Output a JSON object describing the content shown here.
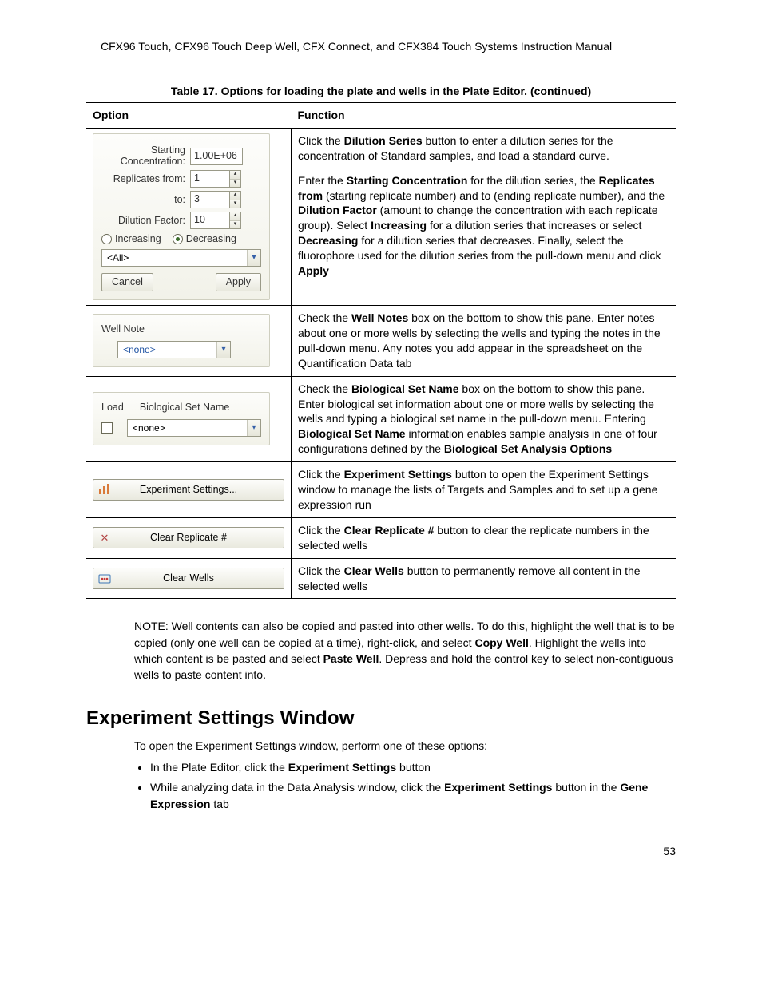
{
  "header": "CFX96 Touch, CFX96 Touch Deep Well, CFX Connect, and CFX384 Touch Systems Instruction Manual",
  "table_caption": "Table 17. Options for loading the plate and wells in the Plate Editor. (continued)",
  "columns": {
    "option": "Option",
    "function": "Function"
  },
  "dilution": {
    "startConcLabel": "Starting Concentration:",
    "startConcValue": "1.00E+06",
    "replFromLabel": "Replicates from:",
    "replFromValue": "1",
    "replToLabel": "to:",
    "replToValue": "3",
    "dilFactorLabel": "Dilution Factor:",
    "dilFactorValue": "10",
    "increasing": "Increasing",
    "decreasing": "Decreasing",
    "allCombo": "<All>",
    "cancel": "Cancel",
    "apply": "Apply"
  },
  "wellnote": {
    "title": "Well Note",
    "combo": "<none>"
  },
  "bio": {
    "load": "Load",
    "title": "Biological Set Name",
    "combo": "<none>"
  },
  "buttons": {
    "expSettings": "Experiment Settings...",
    "clearRep": "Clear Replicate #",
    "clearWells": "Clear Wells"
  },
  "func": {
    "dilution_p1_a": "Click the ",
    "dilution_p1_b": "Dilution Series",
    "dilution_p1_c": " button to enter a dilution series for the concentration of Standard samples, and load a standard curve.",
    "dilution_p2_a": "Enter the ",
    "dilution_p2_b": "Starting Concentration",
    "dilution_p2_c": " for the dilution series, the ",
    "dilution_p2_d": "Replicates from",
    "dilution_p2_e": " (starting replicate number) and to (ending replicate number), and the ",
    "dilution_p2_f": "Dilution Factor",
    "dilution_p2_g": " (amount to change the concentration with each replicate group). Select ",
    "dilution_p2_h": "Increasing",
    "dilution_p2_i": " for a dilution series that increases or select ",
    "dilution_p2_j": "Decreasing",
    "dilution_p2_k": " for a dilution series that decreases. Finally, select the fluorophore used for the dilution series from the pull-down menu and click ",
    "dilution_p2_l": "Apply",
    "wellnote_a": "Check the ",
    "wellnote_b": "Well Notes",
    "wellnote_c": " box on the bottom to show this pane. Enter notes about one or more wells by selecting the wells and typing the notes in the pull-down menu. Any notes you add appear in the spreadsheet on the Quantification Data tab",
    "bio_a": "Check the ",
    "bio_b": "Biological Set Name",
    "bio_c": " box on the bottom to show this pane. Enter biological set information about one or more wells by selecting the wells and typing a biological set name in the pull-down menu. Entering ",
    "bio_d": "Biological Set Name",
    "bio_e": " information enables sample analysis in one of four configurations defined by the ",
    "bio_f": "Biological Set Analysis Options",
    "exp_a": "Click the ",
    "exp_b": "Experiment Settings",
    "exp_c": " button to open the Experiment Settings window to manage the lists of Targets and Samples and to set up a gene expression run",
    "clr_a": "Click the ",
    "clr_b": "Clear Replicate #",
    "clr_c": " button to clear the replicate numbers in the selected wells",
    "clw_a": "Click the ",
    "clw_b": "Clear Wells",
    "clw_c": " button to permanently remove all content in the selected wells"
  },
  "note": {
    "a": "NOTE: Well contents can also be copied and pasted into other wells. To do this, highlight the well that is to be copied (only one well can be copied at a time), right-click, and select ",
    "b": "Copy Well",
    "c": ". Highlight the wells into which content is be pasted and select ",
    "d": "Paste Well",
    "e": ". Depress and hold the control key to select non-contiguous wells to paste content into."
  },
  "section": "Experiment Settings Window",
  "open_intro": "To open the Experiment Settings window, perform one of these options:",
  "bullets": {
    "b1_a": "In the Plate Editor, click the ",
    "b1_b": "Experiment Settings",
    "b1_c": " button",
    "b2_a": "While analyzing data in the Data Analysis window, click the ",
    "b2_b": "Experiment Settings",
    "b2_c": " button in the ",
    "b2_d": "Gene Expression",
    "b2_e": " tab"
  },
  "page": "53"
}
